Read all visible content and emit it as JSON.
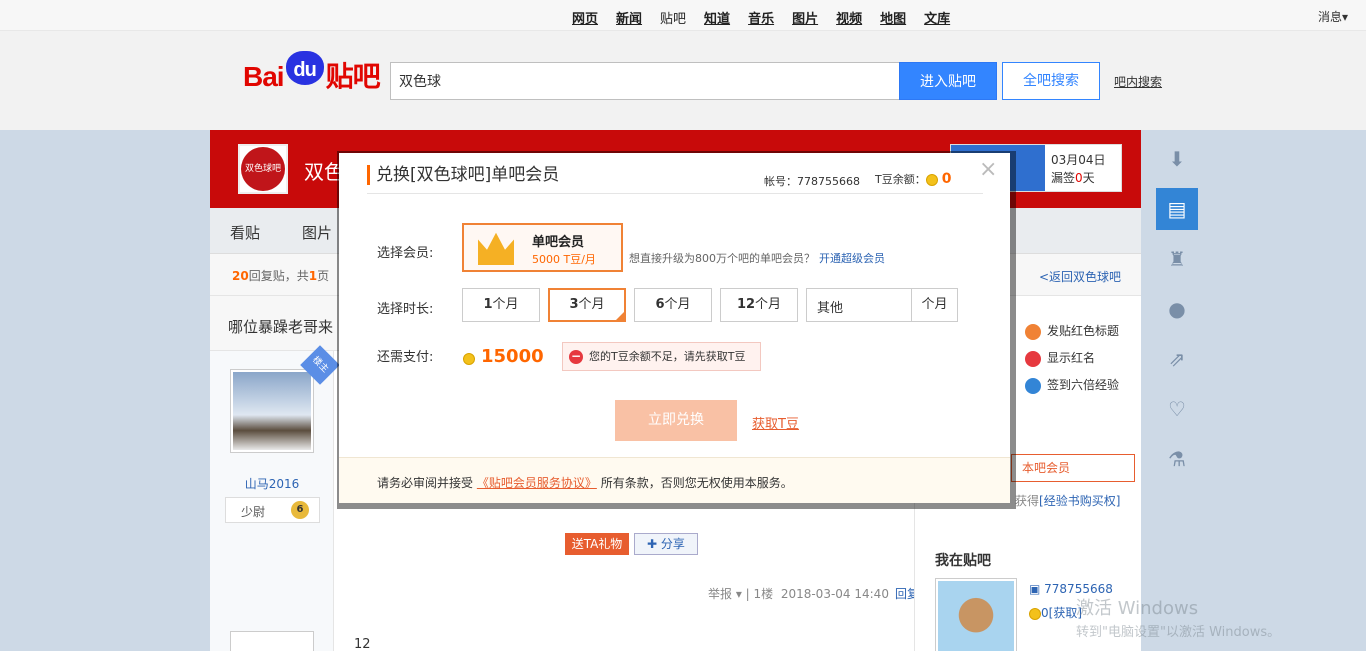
{
  "topnav": {
    "links": [
      "网页",
      "新闻",
      "贴吧",
      "知道",
      "音乐",
      "图片",
      "视频",
      "地图",
      "文库"
    ],
    "messages": "消息"
  },
  "header": {
    "logo_bai": "Bai",
    "logo_du": "du",
    "logo_tieba": "贴吧",
    "search_value": "双色球",
    "enter_label": "进入贴吧",
    "all_search_label": "全吧搜索",
    "inner_search_label": "吧内搜索"
  },
  "banner": {
    "forum_icon_text": "双色球吧",
    "forum_name": "双色",
    "sign_date": "03月04日",
    "sign_missed_prefix": "漏签",
    "sign_missed_count": "0",
    "sign_missed_suffix": "天"
  },
  "tabs": [
    "看贴",
    "图片"
  ],
  "content": {
    "reply_count": "20",
    "reply_text_1": "回复贴，共",
    "page_count": "1",
    "reply_text_2": "页",
    "back_link": "<返回双色球吧",
    "post_title": "哪位暴躁老哥来",
    "louzhu": "楼主",
    "username": "山马2016",
    "rank": "少尉",
    "level": "6",
    "gift_label": "送TA礼物",
    "share_label": "分享",
    "report": "举报",
    "floor": "1楼",
    "post_time": "2018-03-04 14:40",
    "reply_label": "回复",
    "second_post_text": "12"
  },
  "rightcol": {
    "perks": [
      "发贴红色标题",
      "显示红名",
      "签到六倍经验"
    ],
    "open_member": "本吧会员",
    "exp_prefix": "获得",
    "exp_link": "[经验书购买权]",
    "my_bar_title": "我在贴吧",
    "my_id": "778755668",
    "my_tdou": "0",
    "my_tdou_get": "[获取]"
  },
  "watermark": {
    "line1": "激活 Windows",
    "line2": "转到\"电脑设置\"以激活 Windows。"
  },
  "modal": {
    "title": "兑换[双色球吧]单吧会员",
    "account_label": "帐号：778755668",
    "balance_label": "T豆余额：",
    "balance_value": "0",
    "close": "×",
    "select_member_label": "选择会员:",
    "member_name": "单吧会员",
    "member_price": "5000 T豆/月",
    "upgrade_text": "想直接升级为800万个吧的单吧会员？",
    "upgrade_link": "开通超级会员",
    "select_duration_label": "选择时长:",
    "durations": [
      {
        "num": "1",
        "unit": "个月"
      },
      {
        "num": "3",
        "unit": "个月"
      },
      {
        "num": "6",
        "unit": "个月"
      },
      {
        "num": "12",
        "unit": "个月"
      }
    ],
    "other_placeholder": "其他",
    "other_unit": "个月",
    "pay_label": "还需支付:",
    "pay_amount": "15000",
    "warning": "您的T豆余额不足，请先获取T豆",
    "exchange_button": "立即兑换",
    "get_tdou_link": "获取T豆",
    "footer_prefix": "请务必审阅并接受",
    "footer_link": "《贴吧会员服务协议》",
    "footer_suffix": "所有条款，否则您无权使用本服务。"
  },
  "colors": {
    "accent_blue": "#3385ff",
    "brand_red": "#c80a0a",
    "orange": "#f08235"
  }
}
